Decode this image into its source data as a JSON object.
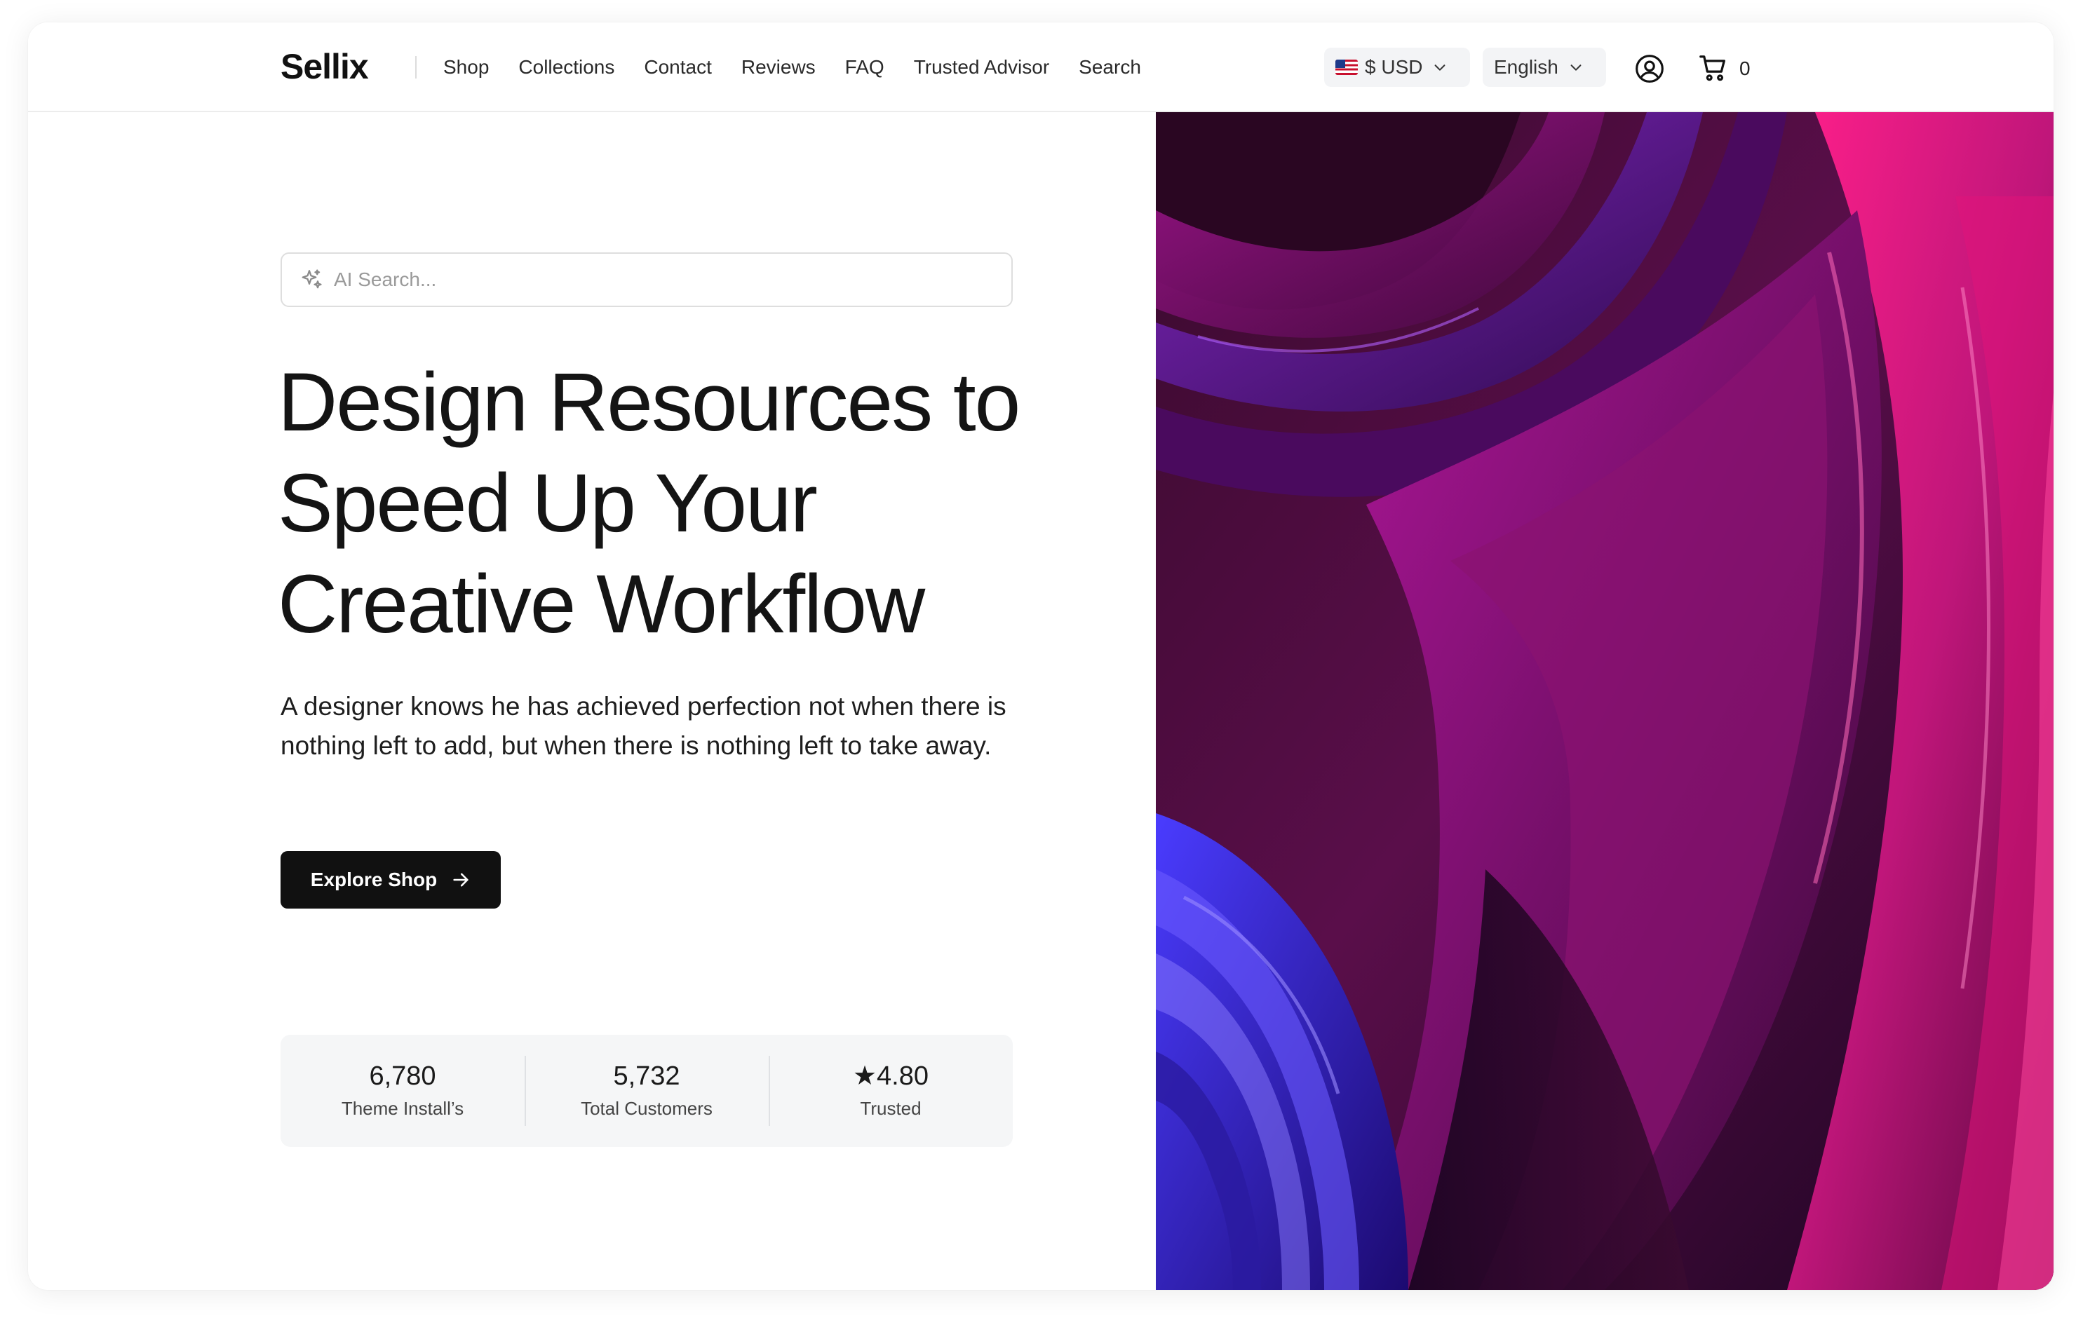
{
  "brand": {
    "name": "Sellix"
  },
  "nav": {
    "items": [
      {
        "label": "Shop"
      },
      {
        "label": "Collections"
      },
      {
        "label": "Contact"
      },
      {
        "label": "Reviews"
      },
      {
        "label": "FAQ"
      },
      {
        "label": "Trusted Advisor"
      },
      {
        "label": "Search"
      }
    ]
  },
  "header": {
    "currency": {
      "flag": "🇺🇸",
      "label": "$ USD"
    },
    "language": {
      "label": "English"
    },
    "cart_count": "0"
  },
  "search": {
    "placeholder": "AI Search..."
  },
  "hero": {
    "title_line1": "Design Resources to",
    "title_line2": "Speed Up Your",
    "title_line3": "Creative Workflow",
    "subtitle": "A designer knows he has achieved perfection not when there is nothing left to add, but when there is nothing left to take away.",
    "cta_label": "Explore Shop"
  },
  "stats": [
    {
      "value": "6,780",
      "label": "Theme Install’s"
    },
    {
      "value": "5,732",
      "label": "Total Customers"
    },
    {
      "value": "★4.80",
      "label": "Trusted"
    }
  ],
  "colors": {
    "primary": "#111111",
    "accent_pink": "#e0147a",
    "accent_purple": "#7a1aa8",
    "accent_blue": "#3a2bd0"
  },
  "icons": {
    "ai": "sparkles-icon",
    "user": "user-circle-icon",
    "cart": "cart-icon",
    "arrow": "arrow-right-icon",
    "chevron": "chevron-down-icon"
  }
}
